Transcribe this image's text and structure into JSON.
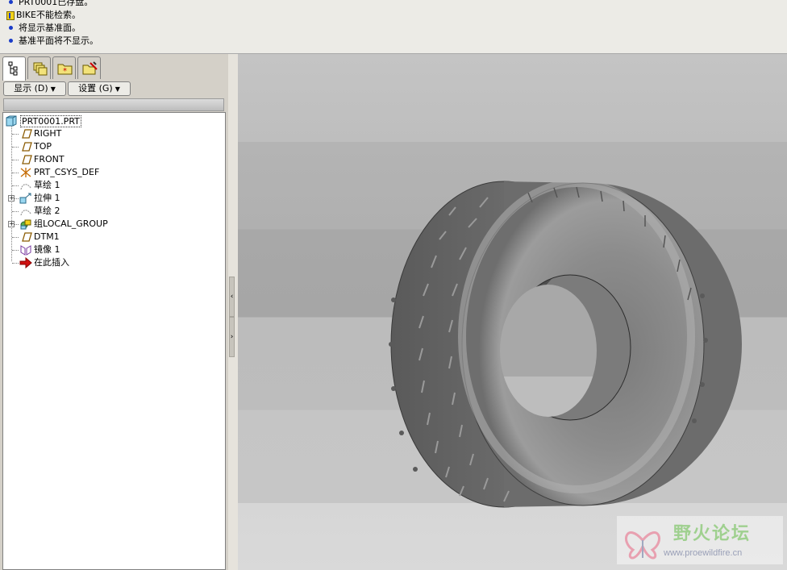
{
  "messages": [
    {
      "type": "info",
      "text": "PRT0001已存盘。"
    },
    {
      "type": "warning",
      "text": "BIKE不能检索。"
    },
    {
      "type": "info",
      "text": "将显示基准面。"
    },
    {
      "type": "info",
      "text": "基准平面将不显示。"
    }
  ],
  "panel": {
    "tabs": [
      "model-tree-icon",
      "layers-icon",
      "favorites-folder-icon",
      "folder-browser-icon"
    ],
    "display_button": "显示 (D)",
    "settings_button": "设置 (G)"
  },
  "tree": {
    "root": "PRT0001.PRT",
    "items": [
      {
        "label": "RIGHT",
        "icon": "datum-plane-icon"
      },
      {
        "label": "TOP",
        "icon": "datum-plane-icon"
      },
      {
        "label": "FRONT",
        "icon": "datum-plane-icon"
      },
      {
        "label": "PRT_CSYS_DEF",
        "icon": "coordinate-system-icon"
      },
      {
        "label": "草绘 1",
        "icon": "sketch-icon"
      },
      {
        "label": "拉伸 1",
        "icon": "extrude-icon",
        "expandable": true
      },
      {
        "label": "草绘 2",
        "icon": "sketch-icon"
      },
      {
        "label": "组LOCAL_GROUP",
        "icon": "group-icon",
        "expandable": true
      },
      {
        "label": "DTM1",
        "icon": "datum-plane-icon"
      },
      {
        "label": "镜像 1",
        "icon": "mirror-icon"
      },
      {
        "label": "在此插入",
        "icon": "insert-here-arrow-icon"
      }
    ]
  },
  "watermark": {
    "title": "野火论坛",
    "url": "www.proewildfire.cn"
  },
  "colors": {
    "bullet": "#1a3cc8",
    "tire_light": "#8e8e8e",
    "tire_dark": "#4a4a4a"
  }
}
